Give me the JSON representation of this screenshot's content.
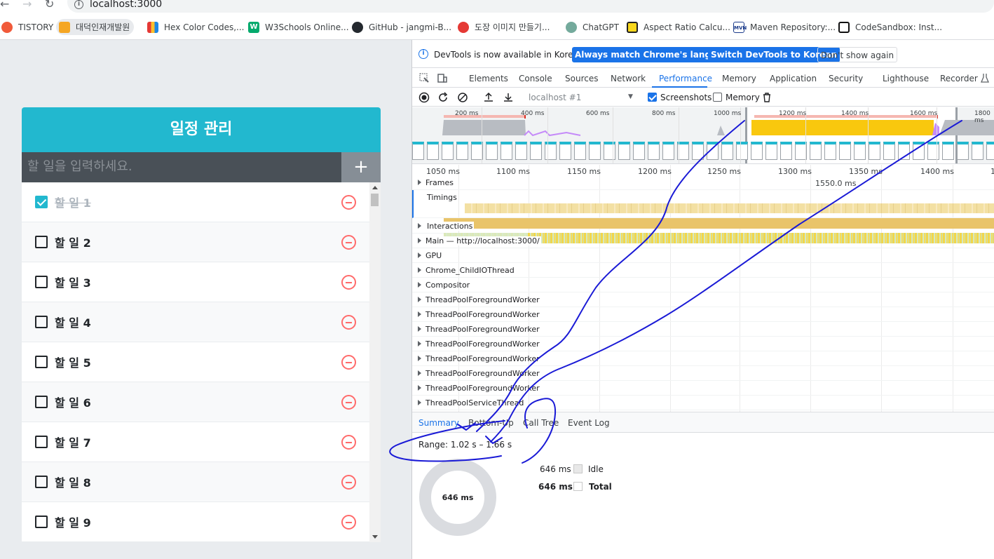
{
  "browser": {
    "url": "localhost:3000",
    "bookmarks": [
      "TISTORY",
      "대덕인재개발원",
      "Hex Color Codes,...",
      "W3Schools Online...",
      "GitHub - jangmi-B...",
      "도장 이미지 만들기...",
      "ChatGPT",
      "Aspect Ratio Calcu...",
      "Maven Repository:...",
      "CodeSandbox: Inst..."
    ]
  },
  "app": {
    "title": "일정 관리",
    "input_placeholder": "할 일을 입력하세요.",
    "add_button": "+",
    "todos": [
      {
        "text": "할 일 1",
        "checked": true
      },
      {
        "text": "할 일 2",
        "checked": false
      },
      {
        "text": "할 일 3",
        "checked": false
      },
      {
        "text": "할 일 4",
        "checked": false
      },
      {
        "text": "할 일 5",
        "checked": false
      },
      {
        "text": "할 일 6",
        "checked": false
      },
      {
        "text": "할 일 7",
        "checked": false
      },
      {
        "text": "할 일 8",
        "checked": false
      },
      {
        "text": "할 일 9",
        "checked": false
      }
    ]
  },
  "devtools": {
    "info": {
      "message": "DevTools is now available in Korean!",
      "btn_match": "Always match Chrome's language",
      "btn_switch": "Switch DevTools to Korean",
      "btn_dismiss": "Don't show again"
    },
    "tabs": [
      "Elements",
      "Console",
      "Sources",
      "Network",
      "Performance",
      "Memory",
      "Application",
      "Security",
      "Lighthouse",
      "Recorder"
    ],
    "active_tab": "Performance",
    "toolbar": {
      "target": "localhost #1",
      "screenshots_label": "Screenshots",
      "screenshots_checked": true,
      "memory_label": "Memory",
      "memory_checked": false
    },
    "overview_ticks": [
      "200 ms",
      "400 ms",
      "600 ms",
      "800 ms",
      "1000 ms",
      "1200 ms",
      "1400 ms",
      "1600 ms",
      "1800 ms"
    ],
    "ruler_ticks": [
      "1050 ms",
      "1100 ms",
      "1150 ms",
      "1200 ms",
      "1250 ms",
      "1300 ms",
      "1350 ms",
      "1400 ms",
      "1"
    ],
    "frame_time": "1550.0 ms",
    "tracks": [
      "Frames",
      "Timings",
      "Interactions",
      "Main — http://localhost:3000/",
      "GPU",
      "Chrome_ChildIOThread",
      "Compositor",
      "ThreadPoolForegroundWorker",
      "ThreadPoolForegroundWorker",
      "ThreadPoolForegroundWorker",
      "ThreadPoolForegroundWorker",
      "ThreadPoolForegroundWorker",
      "ThreadPoolForegroundWorker",
      "ThreadPoolForegroundWorker",
      "ThreadPoolServiceThread"
    ],
    "bottom_tabs": [
      "Summary",
      "Bottom-Up",
      "Call Tree",
      "Event Log"
    ],
    "summary": {
      "range": "Range: 1.02 s – 1.66 s",
      "donut_label": "646 ms",
      "rows": [
        {
          "value": "646 ms",
          "label": "Idle"
        },
        {
          "value": "646 ms",
          "label": "Total"
        }
      ]
    },
    "colors": {
      "accent": "#1a73e8",
      "app_header": "#22b8cf",
      "scripting": "#f5c518",
      "remove": "#ff6b6b"
    }
  }
}
